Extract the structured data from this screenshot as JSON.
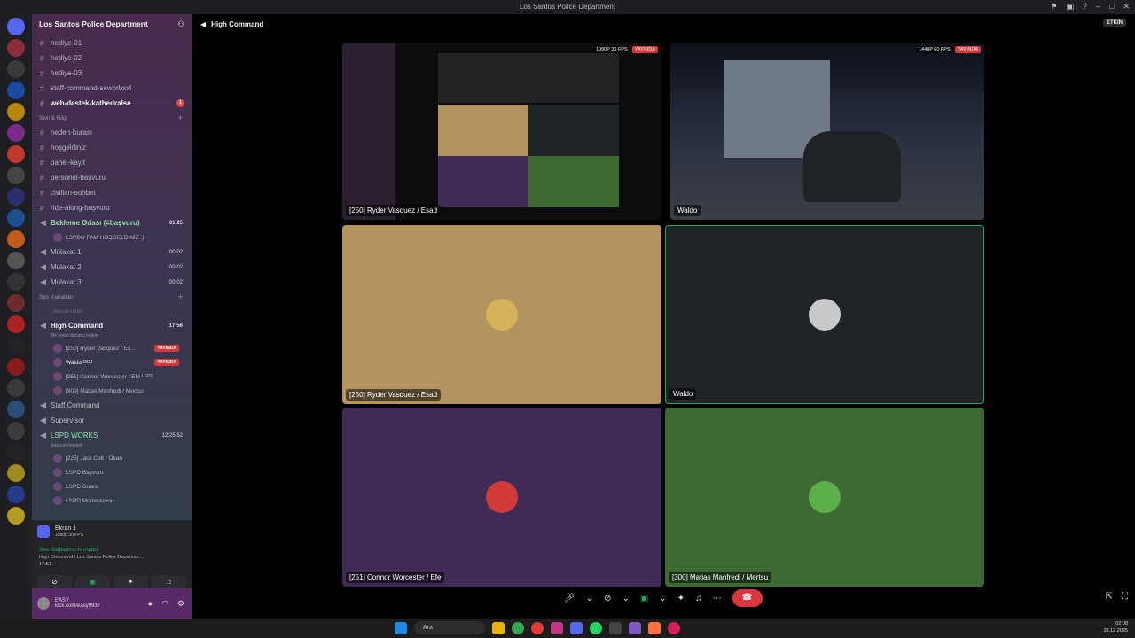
{
  "window": {
    "title": "Los Santos Police Department"
  },
  "server": {
    "name": "Los Santos Police Department"
  },
  "channels_top": [
    {
      "name": "hediye-01",
      "bold": false
    },
    {
      "name": "hediye-02",
      "bold": false
    },
    {
      "name": "hediye-03",
      "bold": false
    },
    {
      "name": "staff-command-seworbxxl",
      "bold": false
    },
    {
      "name": "web-destek-kathedralse",
      "bold": true,
      "badge": "1"
    }
  ],
  "category_sivil": "Sivil & Bilgi",
  "channels_sivil": [
    "neden-burası",
    "hoşgeldiniz",
    "panel-kayıt",
    "personel-başvuru",
    "civillan-sohbet",
    "ride-along-başvuru"
  ],
  "waiting_room": {
    "name": "Bekleme Odası (#başvuru)",
    "count_a": "01",
    "count_b": "25",
    "member": "LSPDU FAM HOŞGELDİNİZ :)"
  },
  "interview_rooms": [
    {
      "name": "Mülakat 1",
      "a": "00",
      "b": "02"
    },
    {
      "name": "Mülakat 2",
      "a": "00",
      "b": "02"
    },
    {
      "name": "Mülakat 3",
      "a": "00",
      "b": "02"
    }
  ],
  "category_voice": "Ses Kanalları",
  "muted_channel": "mesai-uyarı",
  "high_command": {
    "name": "High Command",
    "time": "17:56",
    "status_text": "Bir kanal durumu belirle",
    "members": [
      {
        "name": "[250] Ryder Vasquez / Es...",
        "live": "YAYINDA"
      },
      {
        "name": "Waldo",
        "tag": "DOJ",
        "live": "YAYINDA"
      },
      {
        "name": "[251] Connor Worcester / Efe",
        "tag": "LSPD"
      },
      {
        "name": "[300] Matias Manfredi / Mertsu"
      }
    ]
  },
  "other_voice": [
    "Staff Command",
    "Supervisor"
  ],
  "lspd_works": {
    "name": "LSPD WORKS",
    "time": "12:25:52",
    "status": "kick.com/easyth",
    "members": [
      "[225] Jack Colt / Okan",
      "LSPD Başvuru",
      "LSPD Guard",
      "LSPD Moderasyon"
    ]
  },
  "screen_share": {
    "title": "Ekran 1",
    "quality": "1080p 30 FPS"
  },
  "voice_connection": {
    "title": "Ses Bağlantısı Kuruldu",
    "detail": "High Command / Los Santos Police Departme...",
    "time": "17:51"
  },
  "user": {
    "name": "EASY",
    "status": "kick.com/easy0937"
  },
  "main_header": {
    "channel": "High Command",
    "right_badge": "ETKİN"
  },
  "tiles": [
    {
      "label": "[250] Ryder Vasquez / Esad",
      "quality": "1080P 30 FPS",
      "live": "YAYINDA",
      "kind": "screen-discord"
    },
    {
      "label": "Waldo",
      "quality": "1440P 60 FPS",
      "live": "YAYINDA",
      "kind": "screen-game"
    },
    {
      "label": "[250] Ryder Vasquez / Esad",
      "kind": "avatar",
      "bg": "#b3935e"
    },
    {
      "label": "Waldo",
      "kind": "avatar",
      "bg": "#1f2327"
    },
    {
      "label": "[251] Connor Worcester / Efe",
      "kind": "avatar",
      "bg": "#3f2b55"
    },
    {
      "label": "[300] Matias Manfredi / Mertsu",
      "kind": "avatar",
      "bg": "#3d6a32"
    }
  ],
  "taskbar": {
    "search": "Ara",
    "time": "02:08",
    "date": "28.12.2025"
  },
  "colors": {
    "live": "#da373c",
    "accent": "#5865f2",
    "speaking": "#23a55a"
  }
}
